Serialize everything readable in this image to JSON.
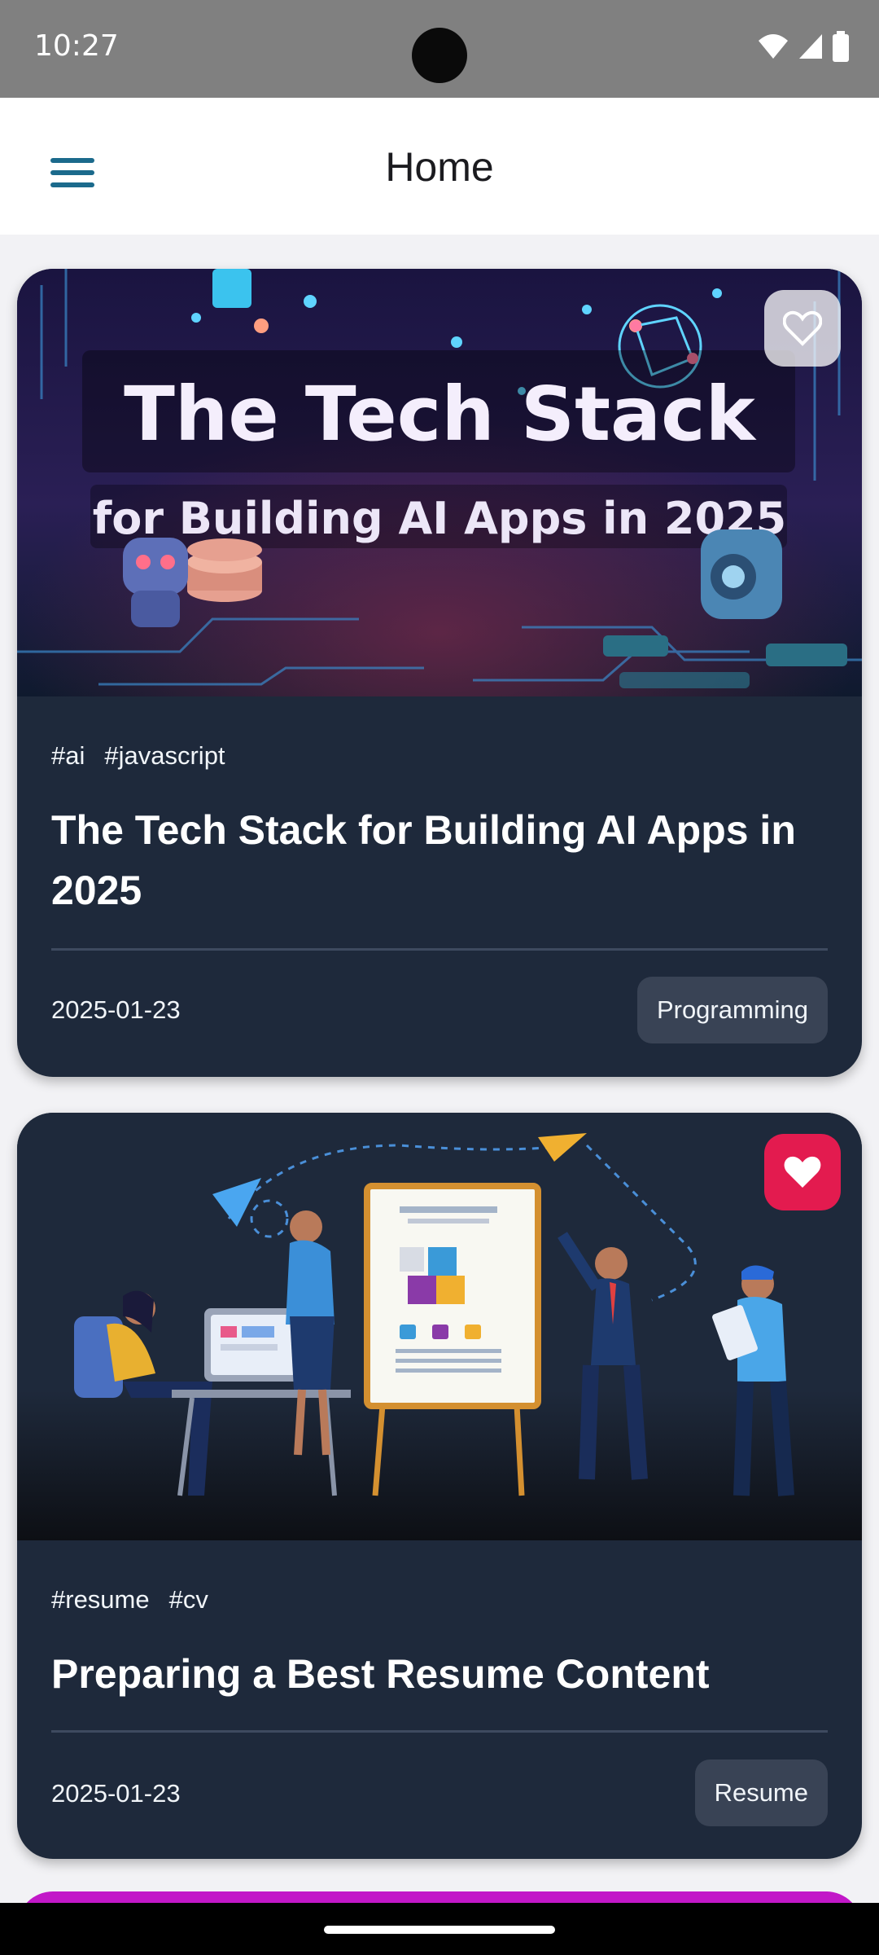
{
  "status_bar": {
    "time": "10:27"
  },
  "app_bar": {
    "title": "Home",
    "menu_icon": "hamburger-menu-icon"
  },
  "posts": [
    {
      "image_text": {
        "line1": "The Tech Stack",
        "line2": "for Building AI Apps in 2025"
      },
      "tags": [
        "#ai",
        "#javascript"
      ],
      "title": "The Tech Stack for Building AI Apps in 2025",
      "date": "2025-01-23",
      "category": "Programming",
      "favorited": false
    },
    {
      "tags": [
        "#resume",
        "#cv"
      ],
      "title": "Preparing a Best Resume Content",
      "date": "2025-01-23",
      "category": "Resume",
      "favorited": true
    }
  ],
  "colors": {
    "card_bg": "#1e293b",
    "favorite_active": "#e31b4f",
    "badge_bg": "#394355",
    "accent": "#1b6a8c"
  }
}
